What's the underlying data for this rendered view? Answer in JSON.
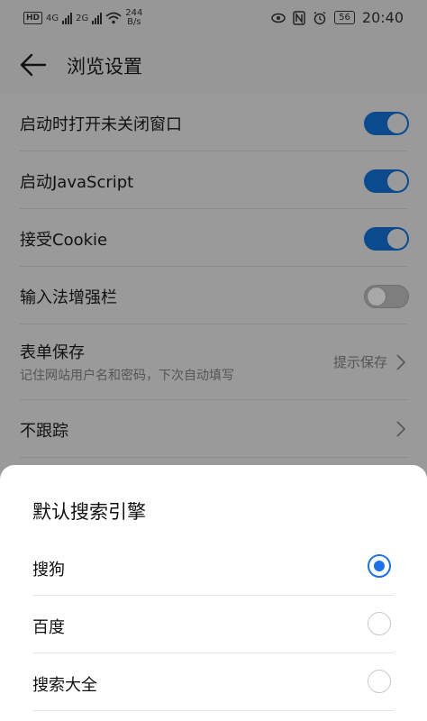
{
  "status_bar": {
    "hd_badge": "HD",
    "sim1_label": "4G",
    "sim2_label": "2G",
    "speed_value": "244",
    "speed_unit": "B/s",
    "battery": "56",
    "time": "20:40",
    "icons": [
      "eye-comfort-icon",
      "nfc-icon",
      "alarm-icon",
      "wifi-icon",
      "signal-icon",
      "battery-icon"
    ]
  },
  "header": {
    "title": "浏览设置"
  },
  "settings": {
    "items": [
      {
        "label": "启动时打开未关闭窗口",
        "control": "switch",
        "state": "on"
      },
      {
        "label": "启动JavaScript",
        "control": "switch",
        "state": "on"
      },
      {
        "label": "接受Cookie",
        "control": "switch",
        "state": "on"
      },
      {
        "label": "输入法增强栏",
        "control": "switch",
        "state": "off"
      },
      {
        "label": "表单保存",
        "subtitle": "记住网站用户名和密码，下次自动填写",
        "value": "提示保存",
        "control": "chevron"
      },
      {
        "label": "不跟踪",
        "control": "chevron"
      }
    ]
  },
  "sheet": {
    "title": "默认搜索引擎",
    "options": [
      {
        "label": "搜狗",
        "selected": true
      },
      {
        "label": "百度",
        "selected": false
      },
      {
        "label": "搜索大全",
        "selected": false
      }
    ]
  },
  "colors": {
    "accent": "#1a73e8",
    "switch_on_dimmed": "#0b4a8d",
    "scrim_background": "#9a9a9a"
  }
}
